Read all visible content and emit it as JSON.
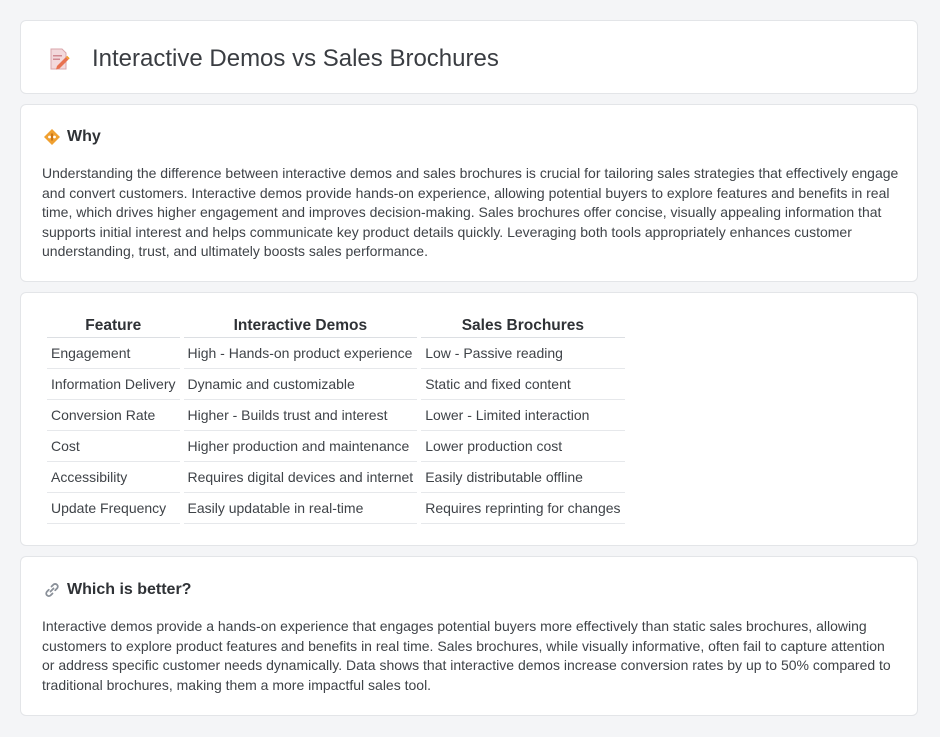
{
  "header": {
    "title": "Interactive Demos vs Sales Brochures",
    "icon": "document-pencil-icon"
  },
  "why": {
    "heading": "Why",
    "icon": "warning-diamond-icon",
    "text": "Understanding the difference between interactive demos and sales brochures is crucial for tailoring sales strategies that effectively engage and convert customers. Interactive demos provide hands-on experience, allowing potential buyers to explore features and benefits in real time, which drives higher engagement and improves decision-making. Sales brochures offer concise, visually appealing information that supports initial interest and helps communicate key product details quickly. Leveraging both tools appropriately enhances customer understanding, trust, and ultimately boosts sales performance."
  },
  "table": {
    "headers": [
      "Feature",
      "Interactive Demos",
      "Sales Brochures"
    ],
    "rows": [
      [
        "Engagement",
        "High - Hands-on product experience",
        "Low - Passive reading"
      ],
      [
        "Information Delivery",
        "Dynamic and customizable",
        "Static and fixed content"
      ],
      [
        "Conversion Rate",
        "Higher - Builds trust and interest",
        "Lower - Limited interaction"
      ],
      [
        "Cost",
        "Higher production and maintenance",
        "Lower production cost"
      ],
      [
        "Accessibility",
        "Requires digital devices and internet",
        "Easily distributable offline"
      ],
      [
        "Update Frequency",
        "Easily updatable in real-time",
        "Requires reprinting for changes"
      ]
    ]
  },
  "better": {
    "heading": "Which is better?",
    "icon": "link-icon",
    "text": "Interactive demos provide a hands-on experience that engages potential buyers more effectively than static sales brochures, allowing customers to explore product features and benefits in real time. Sales brochures, while visually informative, often fail to capture attention or address specific customer needs dynamically. Data shows that interactive demos increase conversion rates by up to 50% compared to traditional brochures, making them a more impactful sales tool."
  },
  "colors": {
    "accent_orange": "#f0a030",
    "icon_pink": "#e0707a",
    "link_gray": "#8a9099"
  }
}
